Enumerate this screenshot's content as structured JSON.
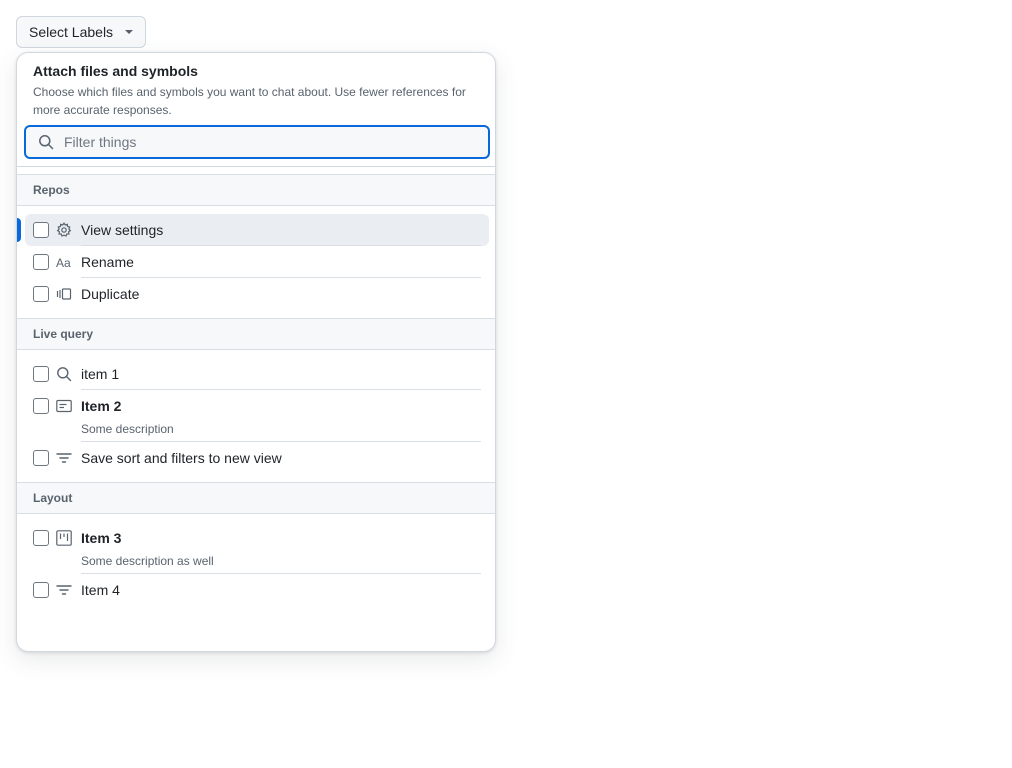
{
  "trigger": {
    "label": "Select Labels"
  },
  "panel": {
    "title": "Attach files and symbols",
    "description_line1": "Choose which files and symbols you want to chat about. Use fewer references for",
    "description_line2": "more accurate responses.",
    "filter": {
      "placeholder": "Filter things",
      "value": ""
    }
  },
  "groups": [
    {
      "label": "Repos",
      "items": [
        {
          "label": "View settings",
          "icon": "gear-icon",
          "active": true
        },
        {
          "label": "Rename",
          "icon": "typography-icon"
        },
        {
          "label": "Duplicate",
          "icon": "versions-icon"
        }
      ]
    },
    {
      "label": "Live query",
      "items": [
        {
          "label": "item 1",
          "icon": "search-icon"
        },
        {
          "label": "Item 2",
          "icon": "note-icon",
          "description": "Some description"
        },
        {
          "label": "Save sort and filters to new view",
          "icon": "filter-icon"
        }
      ]
    },
    {
      "label": "Layout",
      "items": [
        {
          "label": "Item 3",
          "icon": "project-icon",
          "description": "Some description as well"
        },
        {
          "label": "Item 4",
          "icon": "filter-icon"
        }
      ]
    }
  ],
  "colors": {
    "accent": "#0969da",
    "border": "#d0d7de",
    "muted_text": "#59636e",
    "header_bg": "#f6f8fa"
  }
}
